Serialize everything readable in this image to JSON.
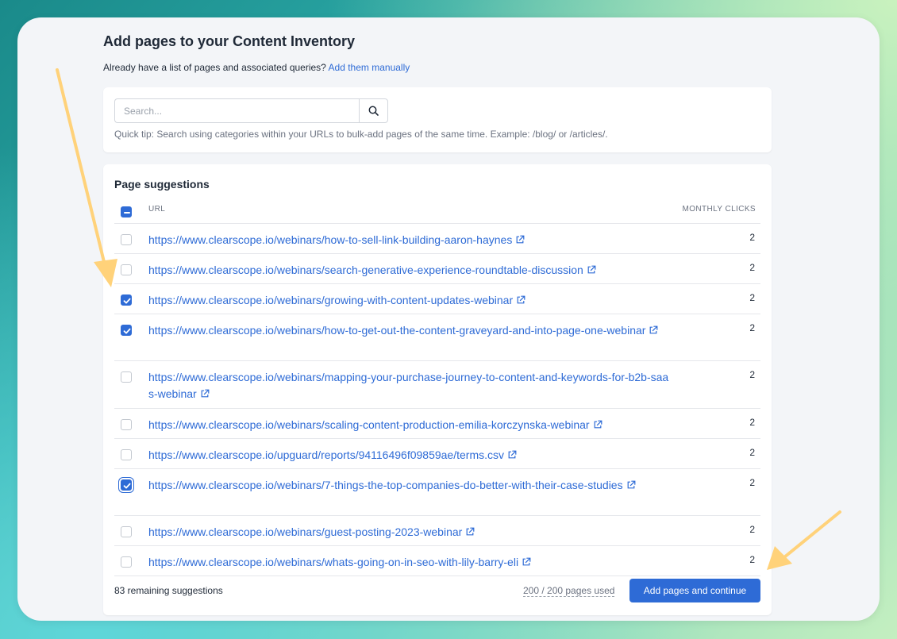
{
  "header": {
    "title": "Add pages to your Content Inventory",
    "subtitle_text": "Already have a list of pages and associated queries?",
    "add_manually_link": "Add them manually"
  },
  "search": {
    "placeholder": "Search...",
    "value": "",
    "button_icon": "search-icon",
    "tip": "Quick tip: Search using categories within your URLs to bulk-add pages of the same time. Example: /blog/ or /articles/."
  },
  "suggestions": {
    "title": "Page suggestions",
    "columns": {
      "url": "URL",
      "clicks": "MONTHLY CLICKS"
    },
    "select_all_state": "indeterminate",
    "rows": [
      {
        "url": "https://www.clearscope.io/webinars/how-to-sell-link-building-aaron-haynes",
        "clicks": "2",
        "checked": false
      },
      {
        "url": "https://www.clearscope.io/webinars/search-generative-experience-roundtable-discussion",
        "clicks": "2",
        "checked": false
      },
      {
        "url": "https://www.clearscope.io/webinars/growing-with-content-updates-webinar",
        "clicks": "2",
        "checked": true
      },
      {
        "url": "https://www.clearscope.io/webinars/how-to-get-out-the-content-graveyard-and-into-page-one-webinar",
        "clicks": "2",
        "checked": true
      },
      {
        "url": "https://www.clearscope.io/webinars/mapping-your-purchase-journey-to-content-and-keywords-for-b2b-saas-webinar",
        "clicks": "2",
        "checked": false
      },
      {
        "url": "https://www.clearscope.io/webinars/scaling-content-production-emilia-korczynska-webinar",
        "clicks": "2",
        "checked": false
      },
      {
        "url": "https://www.clearscope.io/upguard/reports/94116496f09859ae/terms.csv",
        "clicks": "2",
        "checked": false
      },
      {
        "url": "https://www.clearscope.io/webinars/7-things-the-top-companies-do-better-with-their-case-studies",
        "clicks": "2",
        "checked": true
      },
      {
        "url": "https://www.clearscope.io/webinars/guest-posting-2023-webinar",
        "clicks": "2",
        "checked": false
      },
      {
        "url": "https://www.clearscope.io/webinars/whats-going-on-in-seo-with-lily-barry-eli",
        "clicks": "2",
        "checked": false
      }
    ]
  },
  "footer": {
    "remaining": "83 remaining suggestions",
    "pages_used": "200 / 200 pages used",
    "add_button": "Add pages and continue"
  },
  "colors": {
    "accent": "#2e6bd6",
    "arrow": "#ffd27a"
  }
}
